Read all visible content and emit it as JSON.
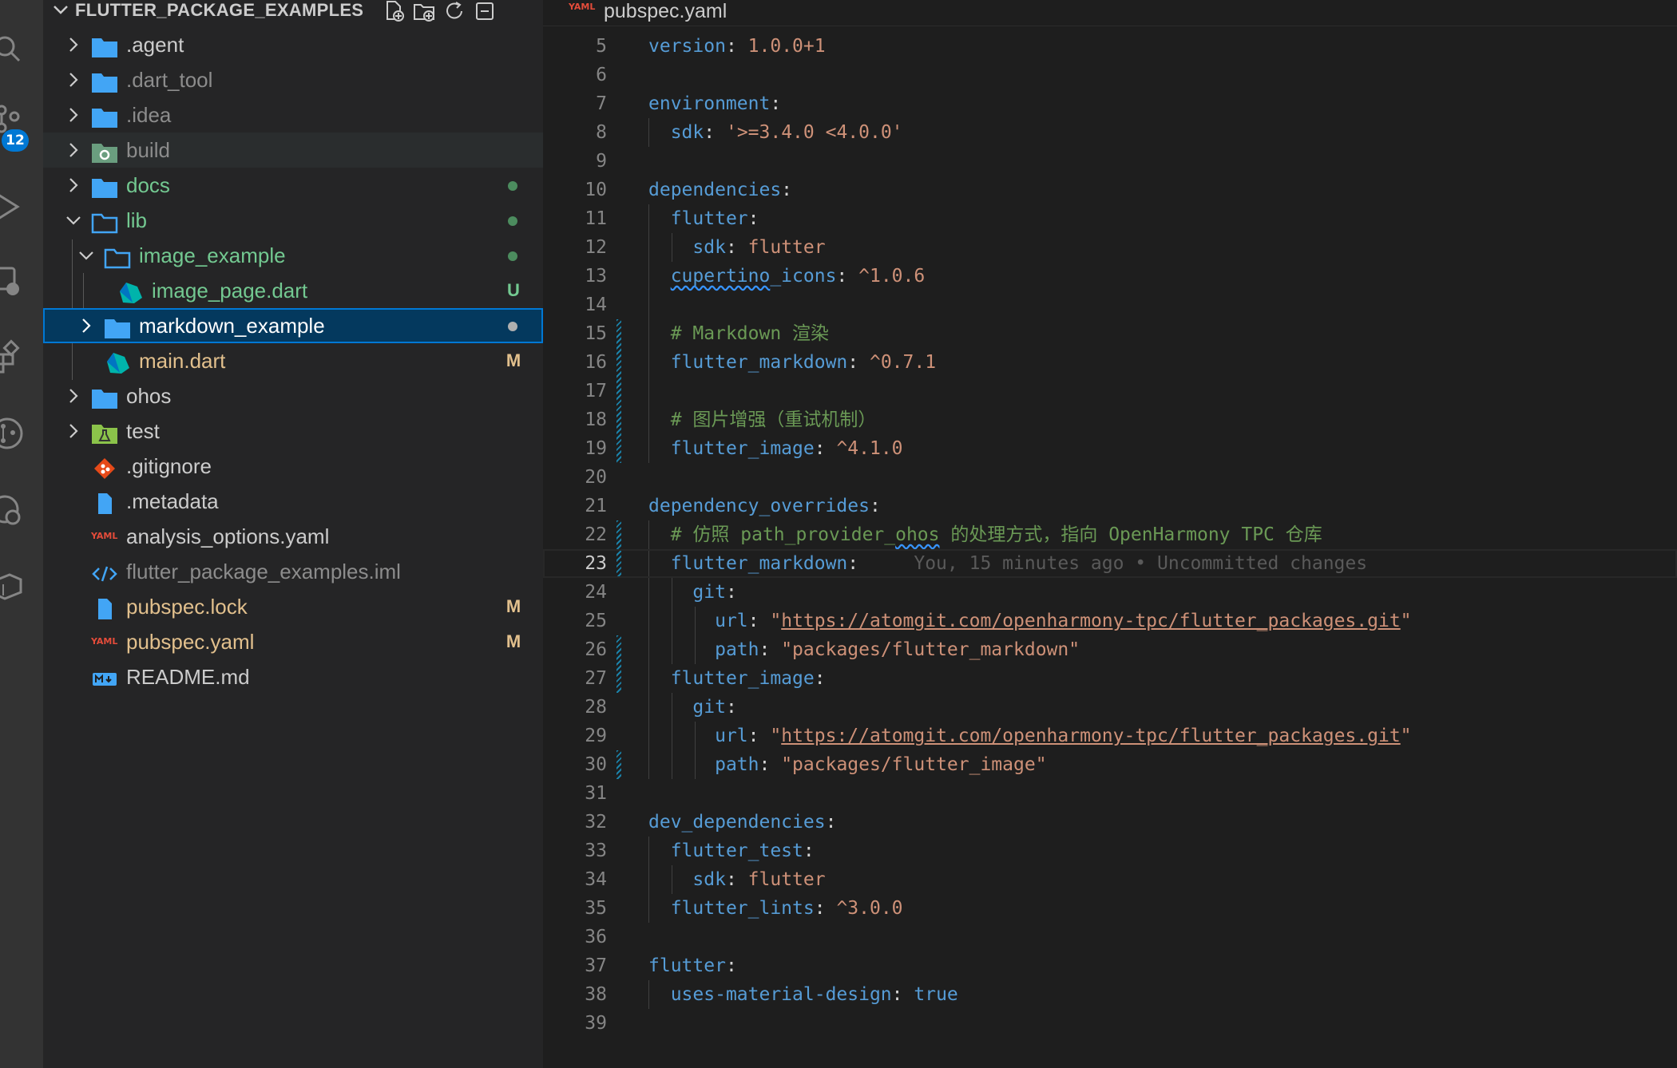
{
  "explorer": {
    "title": "FLUTTER_PACKAGE_EXAMPLES",
    "items": [
      {
        "label": ".agent",
        "decoration": ""
      },
      {
        "label": ".dart_tool",
        "decoration": ""
      },
      {
        "label": ".idea",
        "decoration": ""
      },
      {
        "label": "build",
        "decoration": ""
      },
      {
        "label": "docs",
        "decoration": "dot"
      },
      {
        "label": "lib",
        "decoration": "dot"
      },
      {
        "label": "image_example",
        "decoration": "dot"
      },
      {
        "label": "image_page.dart",
        "decoration": "U"
      },
      {
        "label": "markdown_example",
        "decoration": "dot"
      },
      {
        "label": "main.dart",
        "decoration": "M"
      },
      {
        "label": "ohos",
        "decoration": ""
      },
      {
        "label": "test",
        "decoration": ""
      },
      {
        "label": ".gitignore",
        "decoration": ""
      },
      {
        "label": ".metadata",
        "decoration": ""
      },
      {
        "label": "analysis_options.yaml",
        "decoration": ""
      },
      {
        "label": "flutter_package_examples.iml",
        "decoration": ""
      },
      {
        "label": "pubspec.lock",
        "decoration": "M"
      },
      {
        "label": "pubspec.yaml",
        "decoration": "M"
      },
      {
        "label": "README.md",
        "decoration": ""
      }
    ]
  },
  "activity_bar": {
    "source_control_badge": "12"
  },
  "editor": {
    "tab": {
      "type_label": "YAML",
      "file_name": "pubspec.yaml"
    },
    "current_line": 23,
    "lines": [
      {
        "n": "5",
        "text": "version: 1.0.0+1"
      },
      {
        "n": "6",
        "text": ""
      },
      {
        "n": "7",
        "text": "environment:"
      },
      {
        "n": "8",
        "text": "  sdk: '>=3.4.0 <4.0.0'"
      },
      {
        "n": "9",
        "text": ""
      },
      {
        "n": "10",
        "text": "dependencies:"
      },
      {
        "n": "11",
        "text": "  flutter:"
      },
      {
        "n": "12",
        "text": "    sdk: flutter"
      },
      {
        "n": "13",
        "text": "  cupertino_icons: ^1.0.6"
      },
      {
        "n": "14",
        "text": ""
      },
      {
        "n": "15",
        "text": "  # Markdown 渲染"
      },
      {
        "n": "16",
        "text": "  flutter_markdown: ^0.7.1"
      },
      {
        "n": "17",
        "text": ""
      },
      {
        "n": "18",
        "text": "  # 图片增强（重试机制）"
      },
      {
        "n": "19",
        "text": "  flutter_image: ^4.1.0"
      },
      {
        "n": "20",
        "text": ""
      },
      {
        "n": "21",
        "text": "dependency_overrides:"
      },
      {
        "n": "22",
        "text": "  # 仿照 path_provider_ohos 的处理方式，指向 OpenHarmony TPC 仓库"
      },
      {
        "n": "23",
        "text": "  flutter_markdown:"
      },
      {
        "n": "24",
        "text": "    git:"
      },
      {
        "n": "25",
        "text": "      url: \"https://atomgit.com/openharmony-tpc/flutter_packages.git\""
      },
      {
        "n": "26",
        "text": "      path: \"packages/flutter_markdown\""
      },
      {
        "n": "27",
        "text": "  flutter_image:"
      },
      {
        "n": "28",
        "text": "    git:"
      },
      {
        "n": "29",
        "text": "      url: \"https://atomgit.com/openharmony-tpc/flutter_packages.git\""
      },
      {
        "n": "30",
        "text": "      path: \"packages/flutter_image\""
      },
      {
        "n": "31",
        "text": ""
      },
      {
        "n": "32",
        "text": "dev_dependencies:"
      },
      {
        "n": "33",
        "text": "  flutter_test:"
      },
      {
        "n": "34",
        "text": "    sdk: flutter"
      },
      {
        "n": "35",
        "text": "  flutter_lints: ^3.0.0"
      },
      {
        "n": "36",
        "text": ""
      },
      {
        "n": "37",
        "text": "flutter:"
      },
      {
        "n": "38",
        "text": "  uses-material-design: true"
      },
      {
        "n": "39",
        "text": ""
      }
    ],
    "blame": "You, 15 minutes ago • Uncommitted changes"
  },
  "colors": {
    "keyword": "#569cd6",
    "string": "#ce9178",
    "comment": "#6a9955",
    "modified": "#e2c08d",
    "untracked": "#73c991",
    "selection": "#04395e",
    "accent": "#0078d4"
  }
}
